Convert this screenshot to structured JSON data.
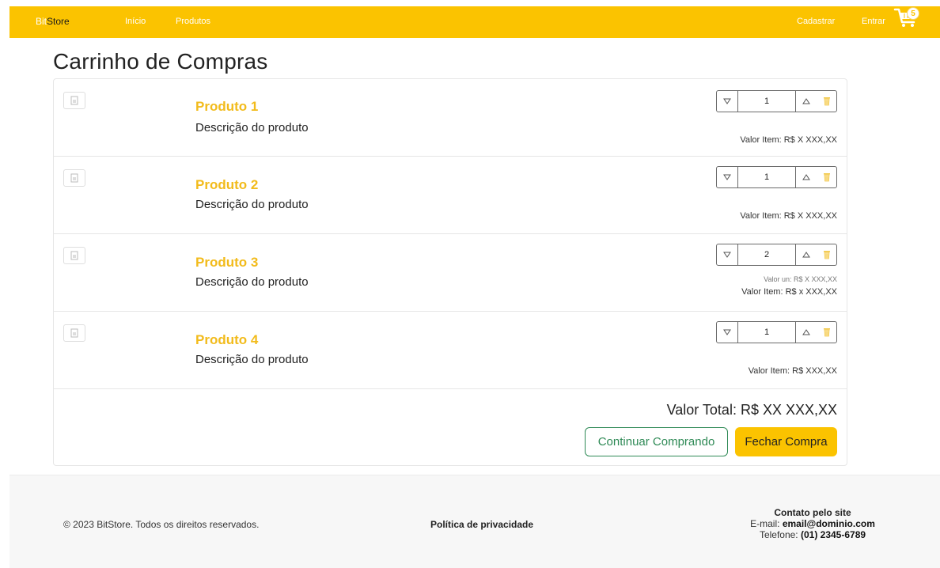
{
  "navbar": {
    "brand_part1": "Bit",
    "brand_part2": "Store",
    "links": [
      "Início",
      "Produtos"
    ],
    "right_links": [
      "Cadastrar",
      "Entrar"
    ],
    "cart_count": "5"
  },
  "page": {
    "title": "Carrinho de Compras"
  },
  "cart": {
    "items": [
      {
        "name": "Produto 1",
        "description": "Descrição do produto",
        "quantity": "1",
        "price": "Valor Item: R$ X XXX,XX"
      },
      {
        "name": "Produto 2",
        "description": "Descrição do produto",
        "quantity": "1",
        "price": "Valor Item: R$ X XXX,XX"
      },
      {
        "name": "Produto 3",
        "description": "Descrição do produto",
        "quantity": "2",
        "unit_price": "Valor un: R$ X XXX,XX",
        "price": "Valor Item: R$ x XXX,XX"
      },
      {
        "name": "Produto 4",
        "description": "Descrição do produto",
        "quantity": "1",
        "price": "Valor Item: R$ XXX,XX"
      }
    ],
    "total": "Valor Total: R$ XX XXX,XX",
    "continue_label": "Continuar Comprando",
    "checkout_label": "Fechar Compra"
  },
  "footer": {
    "copyright": "© 2023 BitStore. Todos os direitos reservados.",
    "privacy": "Política de privacidade",
    "contact_title": "Contato pelo site",
    "email_label": "E-mail:",
    "email": "email@dominio.com",
    "phone_label": "Telefone:",
    "phone": "(01) 2345-6789"
  },
  "colors": {
    "primary": "#fbc300",
    "product_name": "#f2bb1b",
    "outline_green": "#2f8a56"
  },
  "icons": [
    "cart-icon",
    "image-placeholder-icon",
    "triangle-down-icon",
    "triangle-up-icon",
    "trash-icon"
  ]
}
